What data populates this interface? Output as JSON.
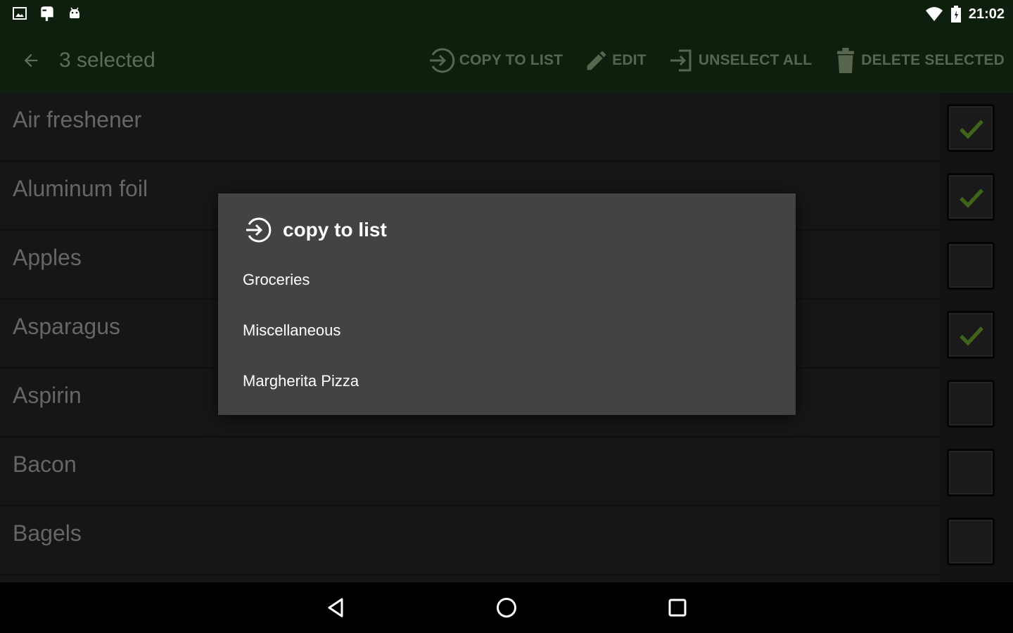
{
  "status_bar": {
    "time": "21:02",
    "left_icons": [
      "image-icon",
      "mailbox-icon",
      "android-icon"
    ],
    "right_icons": [
      "wifi-icon",
      "battery-icon"
    ]
  },
  "toolbar": {
    "title": "3 selected",
    "back_icon": "arrow-left-icon",
    "actions": [
      {
        "label": "COPY TO LIST",
        "icon": "copy-to-list-icon"
      },
      {
        "label": "EDIT",
        "icon": "pencil-icon"
      },
      {
        "label": "UNSELECT ALL",
        "icon": "unselect-icon"
      },
      {
        "label": "DELETE SELECTED",
        "icon": "trash-icon"
      }
    ]
  },
  "list": {
    "items": [
      {
        "label": "Air freshener",
        "checked": true
      },
      {
        "label": "Aluminum foil",
        "checked": true
      },
      {
        "label": "Apples",
        "checked": false
      },
      {
        "label": "Asparagus",
        "checked": true
      },
      {
        "label": "Aspirin",
        "checked": false
      },
      {
        "label": "Bacon",
        "checked": false
      },
      {
        "label": "Bagels",
        "checked": false
      }
    ]
  },
  "dialog": {
    "title": "copy to list",
    "icon": "copy-to-list-icon",
    "options": [
      "Groceries",
      "Miscellaneous",
      "Margherita Pizza"
    ]
  },
  "nav_bar": {
    "buttons": [
      "back-triangle-icon",
      "home-circle-icon",
      "recents-square-icon"
    ]
  },
  "colors": {
    "toolbar_bg": "#0f1f0d",
    "list_bg": "#1b1b1b",
    "dialog_bg": "#434343",
    "check_color": "#4f7a21",
    "muted_action": "#59664f"
  }
}
